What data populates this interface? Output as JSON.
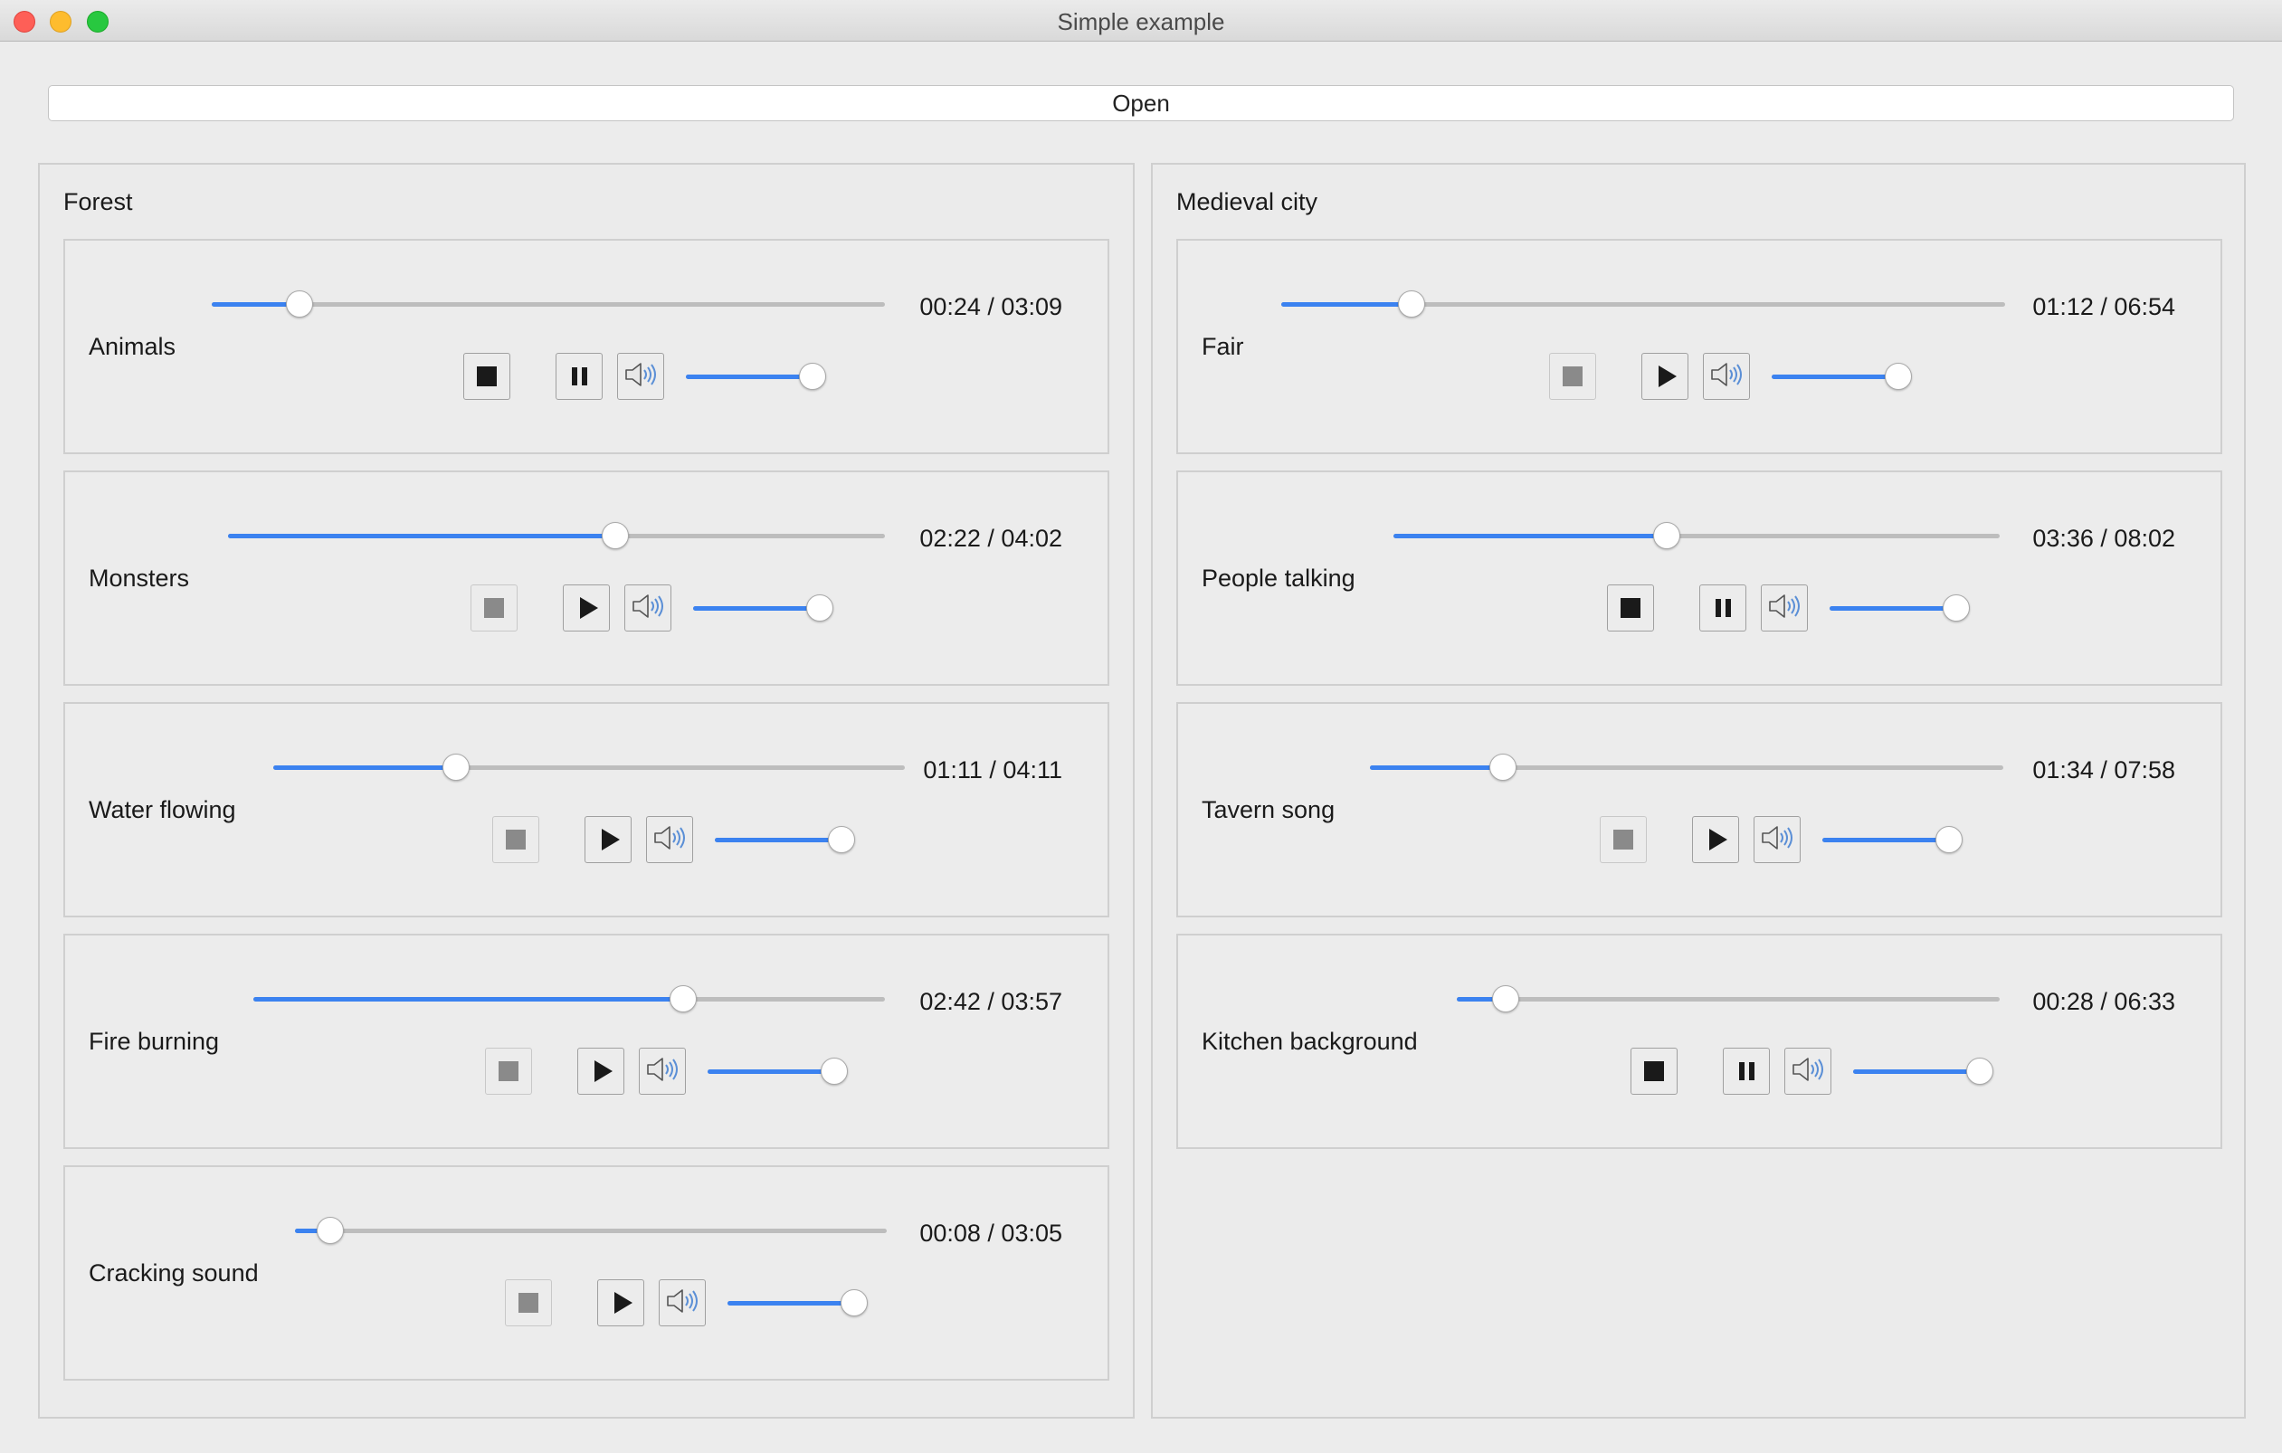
{
  "window": {
    "title": "Simple example"
  },
  "open_label": "Open",
  "groups": [
    {
      "title": "Forest",
      "tracks": [
        {
          "name": "Animals",
          "time": "00:24 / 03:09",
          "progress": 0.13,
          "volume": 1.0,
          "state": "playing"
        },
        {
          "name": "Monsters",
          "time": "02:22 / 04:02",
          "progress": 0.59,
          "volume": 1.0,
          "state": "paused"
        },
        {
          "name": "Water flowing",
          "time": "01:11 / 04:11",
          "progress": 0.29,
          "volume": 1.0,
          "state": "paused"
        },
        {
          "name": "Fire burning",
          "time": "02:42 / 03:57",
          "progress": 0.68,
          "volume": 1.0,
          "state": "paused"
        },
        {
          "name": "Cracking sound",
          "time": "00:08 / 03:05",
          "progress": 0.06,
          "volume": 1.0,
          "state": "paused"
        }
      ]
    },
    {
      "title": "Medieval city",
      "tracks": [
        {
          "name": "Fair",
          "time": "01:12 / 06:54",
          "progress": 0.18,
          "volume": 1.0,
          "state": "paused"
        },
        {
          "name": "People talking",
          "time": "03:36 / 08:02",
          "progress": 0.45,
          "volume": 1.0,
          "state": "playing"
        },
        {
          "name": "Tavern song",
          "time": "01:34 / 07:58",
          "progress": 0.21,
          "volume": 1.0,
          "state": "paused"
        },
        {
          "name": "Kitchen background",
          "time": "00:28 / 06:33",
          "progress": 0.09,
          "volume": 1.0,
          "state": "playing"
        }
      ]
    }
  ],
  "icons": {
    "stop": "stop-icon",
    "pause": "pause-icon",
    "play": "play-icon",
    "volume": "speaker-icon"
  },
  "colors": {
    "accent": "#3b82f0",
    "rail": "#bdbdbd",
    "background": "#ececec"
  }
}
